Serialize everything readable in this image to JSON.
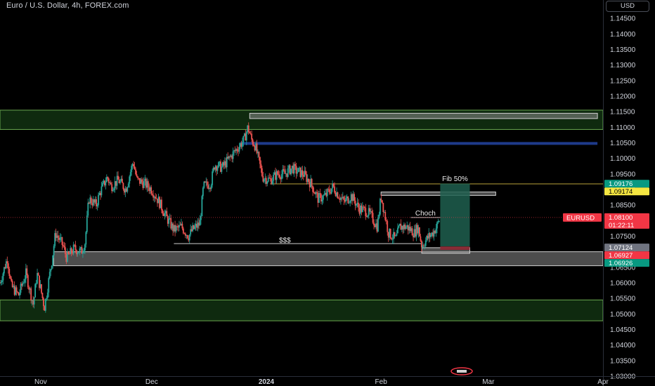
{
  "header": {
    "title": "Euro / U.S. Dollar, 4h, FOREX.com",
    "currency_button": "USD"
  },
  "colors": {
    "up": "#26a69a",
    "down": "#ef5350",
    "background": "#000000",
    "green_zone": "#1b4d1b",
    "grey_zone": "#8c8c8c",
    "blue_line": "#1e3a8a",
    "fib_line": "#b8a23a",
    "long_profit": "#1f5f4f",
    "long_loss": "#8b2631",
    "price_tag": "#f23645",
    "green_tag": "#089981",
    "yellow_tag": "#f5e642"
  },
  "chart_data": {
    "type": "candlestick",
    "symbol": "EURUSD",
    "timeframe": "4h",
    "ylim": [
      1.03,
      1.15
    ],
    "y_ticks": [
      "1.14500",
      "1.14000",
      "1.13500",
      "1.13000",
      "1.12500",
      "1.12000",
      "1.11500",
      "1.11000",
      "1.10500",
      "1.10000",
      "1.09500",
      "1.09000",
      "1.08500",
      "1.08000",
      "1.07500",
      "1.07000",
      "1.06500",
      "1.06000",
      "1.05500",
      "1.05000",
      "1.04500",
      "1.04000",
      "1.03500",
      "1.03000"
    ],
    "x_ticks": [
      {
        "label": "Nov",
        "day": 26
      },
      {
        "label": "Dec",
        "day": 56
      },
      {
        "label": "2024",
        "day": 87
      },
      {
        "label": "Feb",
        "day": 118
      },
      {
        "label": "Mar",
        "day": 147
      },
      {
        "label": "Apr",
        "day": 178
      }
    ],
    "x_range_days": [
      15,
      178
    ],
    "price_path": [
      [
        15,
        1.06
      ],
      [
        17,
        1.068
      ],
      [
        18,
        1.059
      ],
      [
        20,
        1.056
      ],
      [
        22,
        1.063
      ],
      [
        24,
        1.053
      ],
      [
        25,
        1.063
      ],
      [
        26,
        1.058
      ],
      [
        27,
        1.052
      ],
      [
        29,
        1.067
      ],
      [
        30,
        1.076
      ],
      [
        32,
        1.072
      ],
      [
        33,
        1.068
      ],
      [
        35,
        1.071
      ],
      [
        37,
        1.07
      ],
      [
        38,
        1.073
      ],
      [
        39,
        1.087
      ],
      [
        41,
        1.085
      ],
      [
        42,
        1.089
      ],
      [
        44,
        1.094
      ],
      [
        45,
        1.091
      ],
      [
        47,
        1.093
      ],
      [
        49,
        1.09
      ],
      [
        51,
        1.099
      ],
      [
        52,
        1.093
      ],
      [
        54,
        1.092
      ],
      [
        56,
        1.09
      ],
      [
        58,
        1.086
      ],
      [
        60,
        1.081
      ],
      [
        62,
        1.077
      ],
      [
        64,
        1.078
      ],
      [
        66,
        1.075
      ],
      [
        67,
        1.077
      ],
      [
        69,
        1.079
      ],
      [
        70,
        1.091
      ],
      [
        72,
        1.092
      ],
      [
        73,
        1.098
      ],
      [
        75,
        1.097
      ],
      [
        77,
        1.1
      ],
      [
        79,
        1.103
      ],
      [
        81,
        1.106
      ],
      [
        82,
        1.11
      ],
      [
        83,
        1.106
      ],
      [
        84,
        1.104
      ],
      [
        85,
        1.099
      ],
      [
        86,
        1.094
      ],
      [
        88,
        1.093
      ],
      [
        90,
        1.095
      ],
      [
        92,
        1.095
      ],
      [
        94,
        1.097
      ],
      [
        95,
        1.096
      ],
      [
        97,
        1.095
      ],
      [
        99,
        1.092
      ],
      [
        101,
        1.087
      ],
      [
        103,
        1.088
      ],
      [
        105,
        1.091
      ],
      [
        106,
        1.089
      ],
      [
        108,
        1.086
      ],
      [
        110,
        1.088
      ],
      [
        112,
        1.084
      ],
      [
        114,
        1.083
      ],
      [
        115,
        1.082
      ],
      [
        117,
        1.078
      ],
      [
        118,
        1.088
      ],
      [
        119,
        1.082
      ],
      [
        120,
        1.076
      ],
      [
        122,
        1.074
      ],
      [
        123,
        1.078
      ],
      [
        125,
        1.078
      ],
      [
        127,
        1.076
      ],
      [
        128,
        1.078
      ],
      [
        129,
        1.072
      ],
      [
        131,
        1.075
      ],
      [
        132,
        1.076
      ],
      [
        133,
        1.078
      ],
      [
        134,
        1.081
      ]
    ],
    "zones": [
      {
        "name": "green-zone-upper",
        "kind": "green",
        "x0": 15,
        "x1": 178,
        "y0": 1.1093,
        "y1": 1.1155
      },
      {
        "name": "green-zone-lower",
        "kind": "green",
        "x0": 15,
        "x1": 178,
        "y0": 1.0478,
        "y1": 1.0545
      },
      {
        "name": "grey-supply-box-top",
        "kind": "grey",
        "x0": 82.5,
        "x1": 176.5,
        "y0": 1.1128,
        "y1": 1.1145
      },
      {
        "name": "grey-demand-box",
        "kind": "grey",
        "x0": 29.5,
        "x1": 178,
        "y0": 1.0655,
        "y1": 1.07
      },
      {
        "name": "grey-fib-box",
        "kind": "grey",
        "x0": 118,
        "x1": 149,
        "y0": 1.0881,
        "y1": 1.0892
      },
      {
        "name": "grey-small-box",
        "kind": "grey",
        "x0": 129,
        "x1": 142,
        "y0": 1.0695,
        "y1": 1.0713
      }
    ],
    "lines": [
      {
        "name": "blue-line",
        "kind": "blue",
        "x0": 80,
        "x1": 176.5,
        "y": 1.1048
      },
      {
        "name": "fib-50-line",
        "kind": "fib",
        "x0": 88,
        "x1": 178,
        "y": 1.0918
      },
      {
        "name": "liquidity-line",
        "kind": "white",
        "x0": 62,
        "x1": 129,
        "y": 1.0726
      },
      {
        "name": "choch-line",
        "kind": "white",
        "x0": 126,
        "x1": 134,
        "y": 1.081
      }
    ],
    "position": {
      "x0": 134,
      "x1": 142,
      "entry": 1.0717,
      "target": 1.0919,
      "stop": 1.0706
    },
    "annotations": [
      {
        "name": "fib-50-label",
        "text": "Fib 50%",
        "x": 138,
        "y": 1.0927
      },
      {
        "name": "choch-label",
        "text": "Choch",
        "x": 130,
        "y": 1.0816
      },
      {
        "name": "liquidity-label",
        "text": "$$$",
        "x": 92,
        "y": 1.073
      }
    ],
    "price_tags": [
      {
        "name": "tag-1-09176",
        "text": "1.09176",
        "y": 1.09176,
        "bg": "#089981",
        "fg": "#ffffff"
      },
      {
        "name": "tag-1-09174",
        "text": "1.09174",
        "y": 1.09174,
        "bg": "#f5e642",
        "fg": "#000000"
      },
      {
        "name": "tag-current",
        "text": "1.08100",
        "sub": "01:22:11",
        "y": 1.081,
        "bg": "#f23645",
        "fg": "#ffffff"
      },
      {
        "name": "tag-1-07124",
        "text": "1.07124",
        "y": 1.07124,
        "bg": "#707480",
        "fg": "#ffffff"
      },
      {
        "name": "tag-1-06927",
        "text": "1.06927",
        "y": 1.06927,
        "bg": "#f23645",
        "fg": "#ffffff"
      },
      {
        "name": "tag-1-06926",
        "text": "1.06926",
        "y": 1.06926,
        "bg": "#089981",
        "fg": "#ffffff"
      }
    ],
    "symbol_tag": "EURUSD"
  }
}
